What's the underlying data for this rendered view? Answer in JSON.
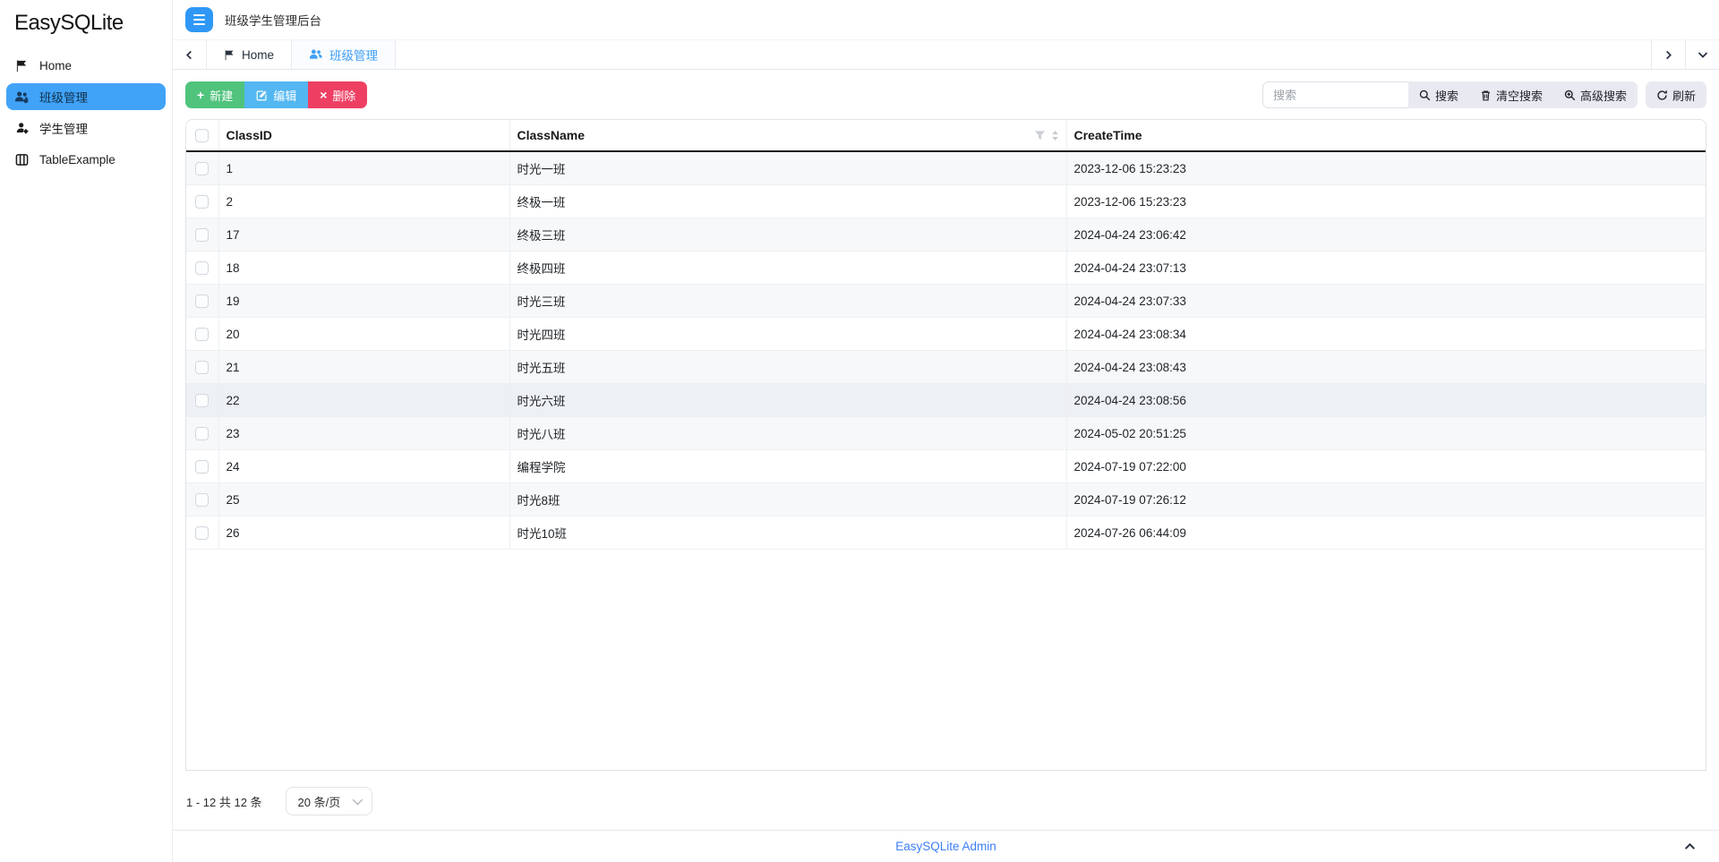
{
  "app": {
    "brand": "EasySQLite",
    "header_title": "班级学生管理后台",
    "footer_link": "EasySQLite Admin"
  },
  "sidebar": {
    "items": [
      {
        "label": "Home",
        "icon": "flag-icon",
        "active": false
      },
      {
        "label": "班级管理",
        "icon": "users-gear-icon",
        "active": true
      },
      {
        "label": "学生管理",
        "icon": "user-gear-icon",
        "active": false
      },
      {
        "label": "TableExample",
        "icon": "table-icon",
        "active": false
      }
    ]
  },
  "tabs": [
    {
      "label": "Home",
      "icon": "flag-icon",
      "active": false
    },
    {
      "label": "班级管理",
      "icon": "users-icon",
      "active": true
    }
  ],
  "toolbar": {
    "new_label": "新建",
    "edit_label": "编辑",
    "delete_label": "删除",
    "search_placeholder": "搜索",
    "search_value": "",
    "search_label": "搜索",
    "clear_search_label": "清空搜索",
    "advanced_search_label": "高级搜索",
    "refresh_label": "刷新"
  },
  "table": {
    "columns": [
      "ClassID",
      "ClassName",
      "CreateTime"
    ],
    "hover_row_index": 7,
    "rows": [
      {
        "id": "1",
        "name": "时光一班",
        "time": "2023-12-06 15:23:23"
      },
      {
        "id": "2",
        "name": "终极一班",
        "time": "2023-12-06 15:23:23"
      },
      {
        "id": "17",
        "name": "终极三班",
        "time": "2024-04-24 23:06:42"
      },
      {
        "id": "18",
        "name": "终极四班",
        "time": "2024-04-24 23:07:13"
      },
      {
        "id": "19",
        "name": "时光三班",
        "time": "2024-04-24 23:07:33"
      },
      {
        "id": "20",
        "name": "时光四班",
        "time": "2024-04-24 23:08:34"
      },
      {
        "id": "21",
        "name": "时光五班",
        "time": "2024-04-24 23:08:43"
      },
      {
        "id": "22",
        "name": "时光六班",
        "time": "2024-04-24 23:08:56"
      },
      {
        "id": "23",
        "name": "时光八班",
        "time": "2024-05-02 20:51:25"
      },
      {
        "id": "24",
        "name": "编程学院",
        "time": "2024-07-19 07:22:00"
      },
      {
        "id": "25",
        "name": "时光8班",
        "time": "2024-07-19 07:26:12"
      },
      {
        "id": "26",
        "name": "时光10班",
        "time": "2024-07-26 06:44:09"
      }
    ]
  },
  "pagination": {
    "summary": "1 - 12 共 12 条",
    "page_size": "20 条/页"
  },
  "colors": {
    "primary_blue": "#3fa0f7",
    "hamburger_blue": "#2f98f6",
    "sidebar_active_bg": "#41a3f8",
    "btn_new_green": "#50c37d",
    "btn_edit_blue": "#53b7f2",
    "btn_delete_red": "#ee3f63",
    "grouped_btn_bg": "#e9eaf1",
    "stripe_row": "#f7f8fa",
    "footer_link": "#3d7ff7"
  }
}
